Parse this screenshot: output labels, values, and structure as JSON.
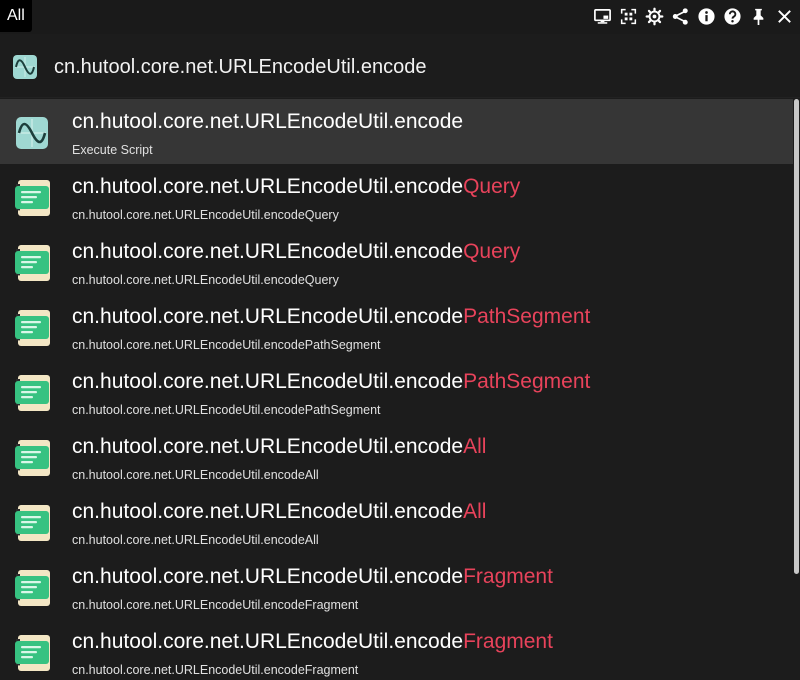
{
  "tabs": {
    "all_label": "All"
  },
  "toolbar": {
    "icons": [
      "monitor-icon",
      "qr-code-icon",
      "gear-icon",
      "share-icon",
      "info-icon",
      "help-icon",
      "pin-icon",
      "close-icon"
    ]
  },
  "search": {
    "value": "cn.hutool.core.net.URLEncodeUtil.encode"
  },
  "results": [
    {
      "prefix": "cn.hutool.core.net.URLEncodeUtil.encode",
      "highlight": "",
      "subtitle": "Execute Script",
      "icon": "script-icon",
      "selected": true
    },
    {
      "prefix": "cn.hutool.core.net.URLEncodeUtil.encode",
      "highlight": "Query",
      "subtitle": "cn.hutool.core.net.URLEncodeUtil.encodeQuery",
      "icon": "snippet-icon"
    },
    {
      "prefix": "cn.hutool.core.net.URLEncodeUtil.encode",
      "highlight": "Query",
      "subtitle": "cn.hutool.core.net.URLEncodeUtil.encodeQuery",
      "icon": "snippet-icon"
    },
    {
      "prefix": "cn.hutool.core.net.URLEncodeUtil.encode",
      "highlight": "PathSegment",
      "subtitle": "cn.hutool.core.net.URLEncodeUtil.encodePathSegment",
      "icon": "snippet-icon"
    },
    {
      "prefix": "cn.hutool.core.net.URLEncodeUtil.encode",
      "highlight": "PathSegment",
      "subtitle": "cn.hutool.core.net.URLEncodeUtil.encodePathSegment",
      "icon": "snippet-icon"
    },
    {
      "prefix": "cn.hutool.core.net.URLEncodeUtil.encode",
      "highlight": "All",
      "subtitle": "cn.hutool.core.net.URLEncodeUtil.encodeAll",
      "icon": "snippet-icon"
    },
    {
      "prefix": "cn.hutool.core.net.URLEncodeUtil.encode",
      "highlight": "All",
      "subtitle": "cn.hutool.core.net.URLEncodeUtil.encodeAll",
      "icon": "snippet-icon"
    },
    {
      "prefix": "cn.hutool.core.net.URLEncodeUtil.encode",
      "highlight": "Fragment",
      "subtitle": "cn.hutool.core.net.URLEncodeUtil.encodeFragment",
      "icon": "snippet-icon"
    },
    {
      "prefix": "cn.hutool.core.net.URLEncodeUtil.encode",
      "highlight": "Fragment",
      "subtitle": "cn.hutool.core.net.URLEncodeUtil.encodeFragment",
      "icon": "snippet-icon"
    }
  ],
  "colors": {
    "highlight": "#e8435b",
    "selected_row": "#363636",
    "background": "#1c1c1c",
    "script_icon": "#9fd8d2",
    "snippet_icon": "#37c281"
  }
}
